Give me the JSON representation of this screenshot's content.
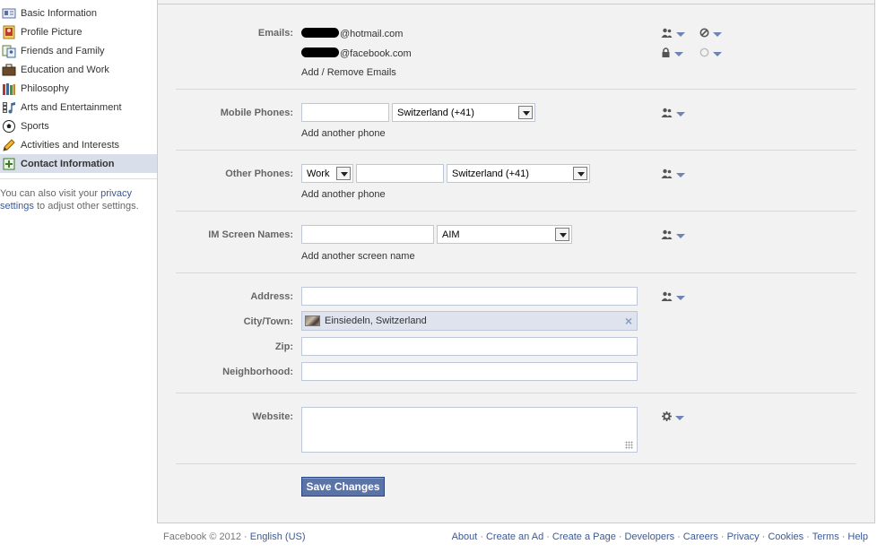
{
  "sidebar": {
    "items": [
      {
        "label": "Basic Information",
        "icon": "id-card-icon",
        "selected": false
      },
      {
        "label": "Profile Picture",
        "icon": "picture-icon",
        "selected": false
      },
      {
        "label": "Friends and Family",
        "icon": "family-icon",
        "selected": false
      },
      {
        "label": "Education and Work",
        "icon": "briefcase-icon",
        "selected": false
      },
      {
        "label": "Philosophy",
        "icon": "books-icon",
        "selected": false
      },
      {
        "label": "Arts and Entertainment",
        "icon": "music-film-icon",
        "selected": false
      },
      {
        "label": "Sports",
        "icon": "soccer-ball-icon",
        "selected": false
      },
      {
        "label": "Activities and Interests",
        "icon": "pencil-icon",
        "selected": false
      },
      {
        "label": "Contact Information",
        "icon": "contact-card-icon",
        "selected": true
      }
    ],
    "note": {
      "prefix": "You can also visit your ",
      "link": "privacy settings",
      "suffix": " to adjust other settings."
    }
  },
  "form": {
    "emails": {
      "label": "Emails:",
      "items": [
        {
          "domain": "@hotmail.com",
          "privacy_icon": "friends-icon",
          "visibility_icon": "hidden-icon"
        },
        {
          "domain": "@facebook.com",
          "privacy_icon": "lock-icon",
          "visibility_icon": "empty-circle-icon"
        }
      ],
      "add_link": "Add / Remove Emails"
    },
    "mobile": {
      "label": "Mobile Phones:",
      "value": "",
      "country": "Switzerland (+41)",
      "add_link": "Add another phone"
    },
    "other_phones": {
      "label": "Other Phones:",
      "type": "Work",
      "value": "",
      "country": "Switzerland (+41)",
      "add_link": "Add another phone"
    },
    "im": {
      "label": "IM Screen Names:",
      "value": "",
      "service": "AIM",
      "add_link": "Add another screen name"
    },
    "address": {
      "label": "Address:",
      "value": ""
    },
    "city": {
      "label": "City/Town:",
      "value": "Einsiedeln, Switzerland"
    },
    "zip": {
      "label": "Zip:",
      "value": ""
    },
    "neighborhood": {
      "label": "Neighborhood:",
      "value": ""
    },
    "website": {
      "label": "Website:",
      "value": ""
    },
    "save_label": "Save Changes"
  },
  "footer": {
    "copyright": "Facebook © 2012 · ",
    "language": "English (US)",
    "links": [
      "About",
      "Create an Ad",
      "Create a Page",
      "Developers",
      "Careers",
      "Privacy",
      "Cookies",
      "Terms",
      "Help"
    ],
    "separator": "·"
  },
  "colors": {
    "link": "#3b5998",
    "selected_nav": "#d8dfea",
    "button": "#5b74a8",
    "panel_bg": "#f2f2f2"
  }
}
